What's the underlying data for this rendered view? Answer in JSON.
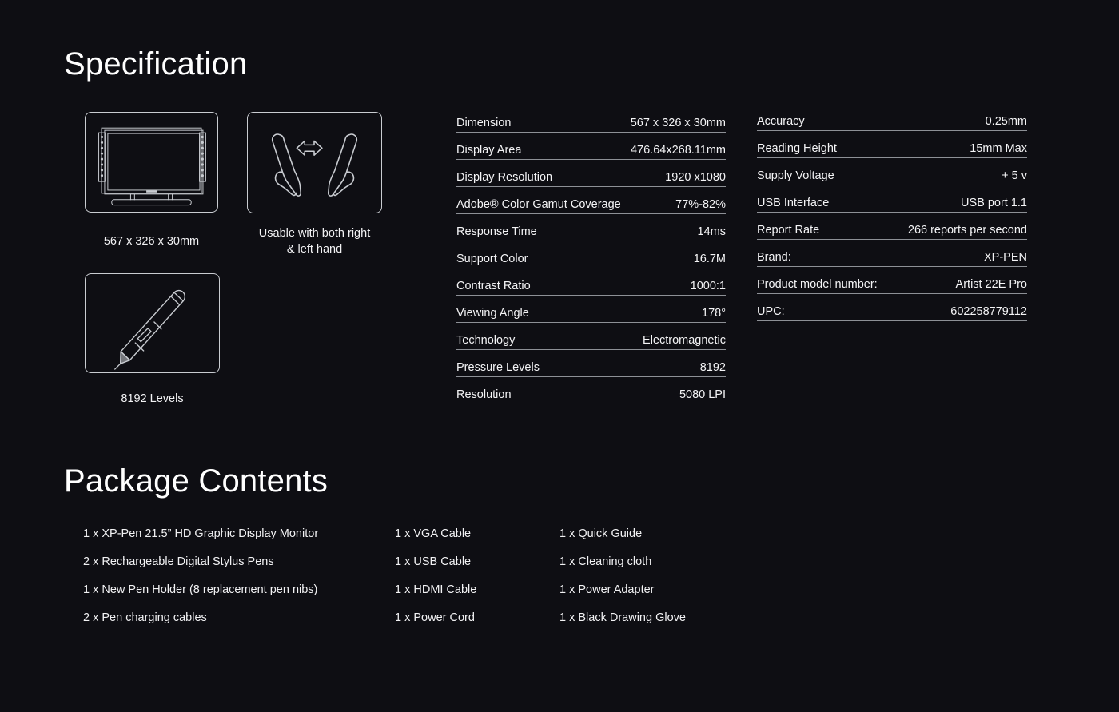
{
  "sections": {
    "specification_title": "Specification",
    "package_title": "Package Contents"
  },
  "icons": [
    {
      "name": "monitor-icon",
      "caption": "567 x 326 x 30mm"
    },
    {
      "name": "both-hands-icon",
      "caption": "Usable with both right\n& left hand"
    },
    {
      "name": "stylus-pen-icon",
      "caption": "8192 Levels"
    }
  ],
  "spec_left": [
    {
      "label": "Dimension",
      "value": "567 x 326 x 30mm"
    },
    {
      "label": "Display Area",
      "value": "476.64x268.11mm"
    },
    {
      "label": "Display Resolution",
      "value": "1920 x1080"
    },
    {
      "label": "Adobe® Color Gamut Coverage",
      "value": "77%-82%"
    },
    {
      "label": "Response Time",
      "value": "14ms"
    },
    {
      "label": "Support Color",
      "value": "16.7M"
    },
    {
      "label": "Contrast Ratio",
      "value": "1000:1"
    },
    {
      "label": "Viewing Angle",
      "value": "178°"
    },
    {
      "label": "Technology",
      "value": "Electromagnetic"
    },
    {
      "label": "Pressure Levels",
      "value": "8192"
    },
    {
      "label": "Resolution",
      "value": "5080 LPI"
    }
  ],
  "spec_right": [
    {
      "label": "Accuracy",
      "value": "0.25mm"
    },
    {
      "label": "Reading Height",
      "value": "15mm Max"
    },
    {
      "label": "Supply Voltage",
      "value": "+ 5 v"
    },
    {
      "label": "USB Interface",
      "value": "USB port 1.1"
    },
    {
      "label": "Report Rate",
      "value": "266 reports per second"
    },
    {
      "label": "Brand:",
      "value": "XP-PEN"
    },
    {
      "label": "Product model number:",
      "value": "Artist 22E Pro"
    },
    {
      "label": "UPC:",
      "value": "602258779112"
    }
  ],
  "package_columns": [
    [
      "1 x XP-Pen 21.5” HD Graphic Display Monitor",
      "2 x Rechargeable Digital Stylus Pens",
      "1 x New Pen Holder (8 replacement pen nibs)",
      "2 x Pen charging cables"
    ],
    [
      "1 x VGA Cable",
      "1 x USB Cable",
      "1 x HDMI Cable",
      "1 x Power Cord"
    ],
    [
      "1 x Quick Guide",
      "1 x Cleaning cloth",
      "1 x Power Adapter",
      "1 x Black Drawing Glove"
    ]
  ],
  "colors": {
    "background": "#0e0e13",
    "text": "#f2f2f4",
    "rule": "#8d9096",
    "icon_stroke": "#c9ccd1"
  }
}
